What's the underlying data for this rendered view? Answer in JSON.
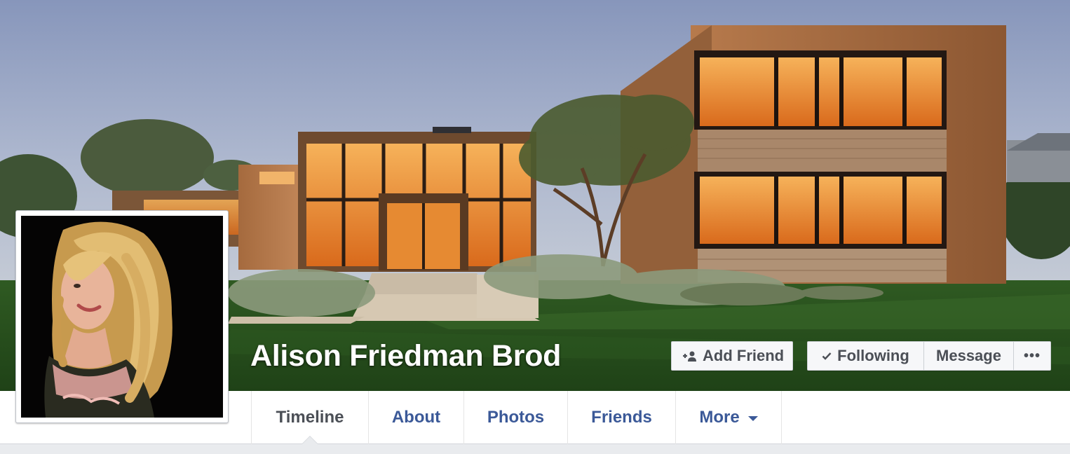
{
  "profile": {
    "name": "Alison Friedman Brod"
  },
  "actions": {
    "add_friend": "Add Friend",
    "following": "Following",
    "message": "Message",
    "more_dots": "•••"
  },
  "tabs": [
    {
      "label": "Timeline",
      "active": true
    },
    {
      "label": "About"
    },
    {
      "label": "Photos"
    },
    {
      "label": "Friends"
    },
    {
      "label": "More"
    }
  ],
  "icons": {
    "add_friend": "add-friend-icon",
    "following": "checkmark-icon",
    "more_tab": "caret-down-icon"
  },
  "colors": {
    "link_blue": "#3b5998",
    "tab_active": "#4b4f56",
    "button_bg": "#f6f7f9",
    "page_bg": "#e9ebee"
  }
}
